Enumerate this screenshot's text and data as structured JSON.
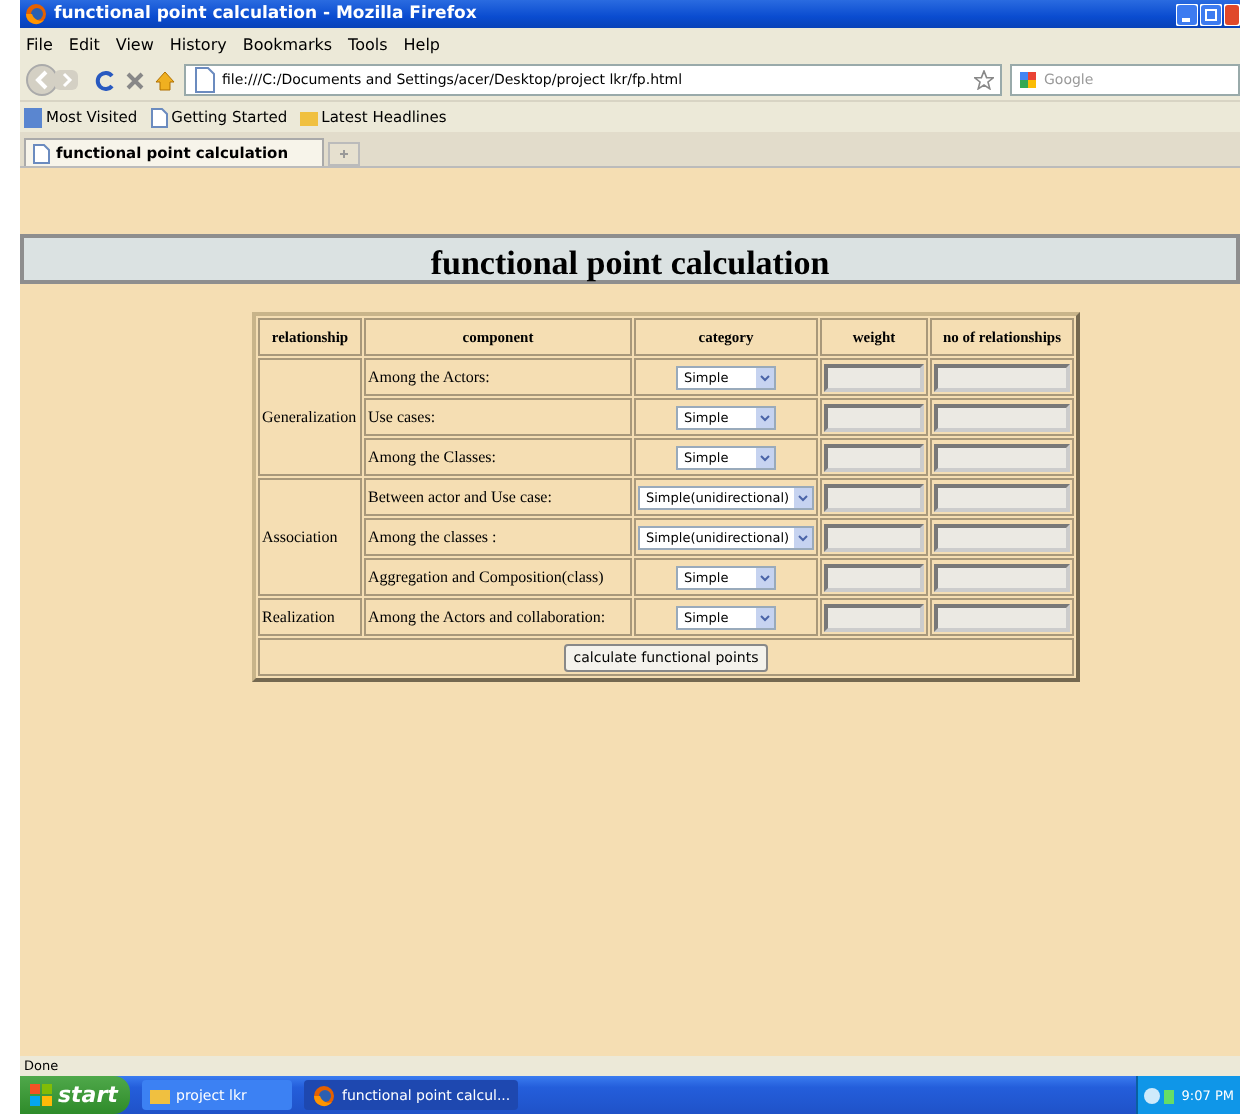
{
  "window": {
    "title": "functional point calculation - Mozilla Firefox"
  },
  "menu": [
    "File",
    "Edit",
    "View",
    "History",
    "Bookmarks",
    "Tools",
    "Help"
  ],
  "navigation": {
    "url": "file:///C:/Documents and Settings/acer/Desktop/project lkr/fp.html",
    "search_placeholder": "Google"
  },
  "bookmarks": [
    {
      "label": "Most Visited"
    },
    {
      "label": "Getting Started"
    },
    {
      "label": "Latest Headlines"
    }
  ],
  "tabs": [
    {
      "label": "functional point calculation",
      "selected": true
    }
  ],
  "page": {
    "heading": "functional point calculation",
    "columns": [
      "relationship",
      "component",
      "category",
      "weight",
      "no of relationships"
    ],
    "groups": [
      {
        "relationship": "Generalization",
        "rows": [
          {
            "component": "Among the Actors:",
            "category": "Simple",
            "wide": false
          },
          {
            "component": "Use cases:",
            "category": "Simple",
            "wide": false
          },
          {
            "component": "Among the Classes:",
            "category": "Simple",
            "wide": false
          }
        ]
      },
      {
        "relationship": "Association",
        "rows": [
          {
            "component": "Between actor and Use case:",
            "category": "Simple(unidirectional)",
            "wide": true
          },
          {
            "component": "Among the classes :",
            "category": "Simple(unidirectional)",
            "wide": true
          },
          {
            "component": "Aggregation and Composition(class)",
            "category": "Simple",
            "wide": false
          }
        ]
      },
      {
        "relationship": "Realization",
        "rows": [
          {
            "component": "Among the Actors and collaboration:",
            "category": "Simple",
            "wide": false
          }
        ]
      }
    ],
    "button": "calculate functional points"
  },
  "status_bar": "Done",
  "taskbar": {
    "start": "start",
    "items": [
      {
        "label": "project lkr",
        "kind": "folder",
        "selected": false
      },
      {
        "label": "functional point calcul...",
        "kind": "browser",
        "selected": true
      }
    ],
    "clock": "9:07 PM"
  }
}
